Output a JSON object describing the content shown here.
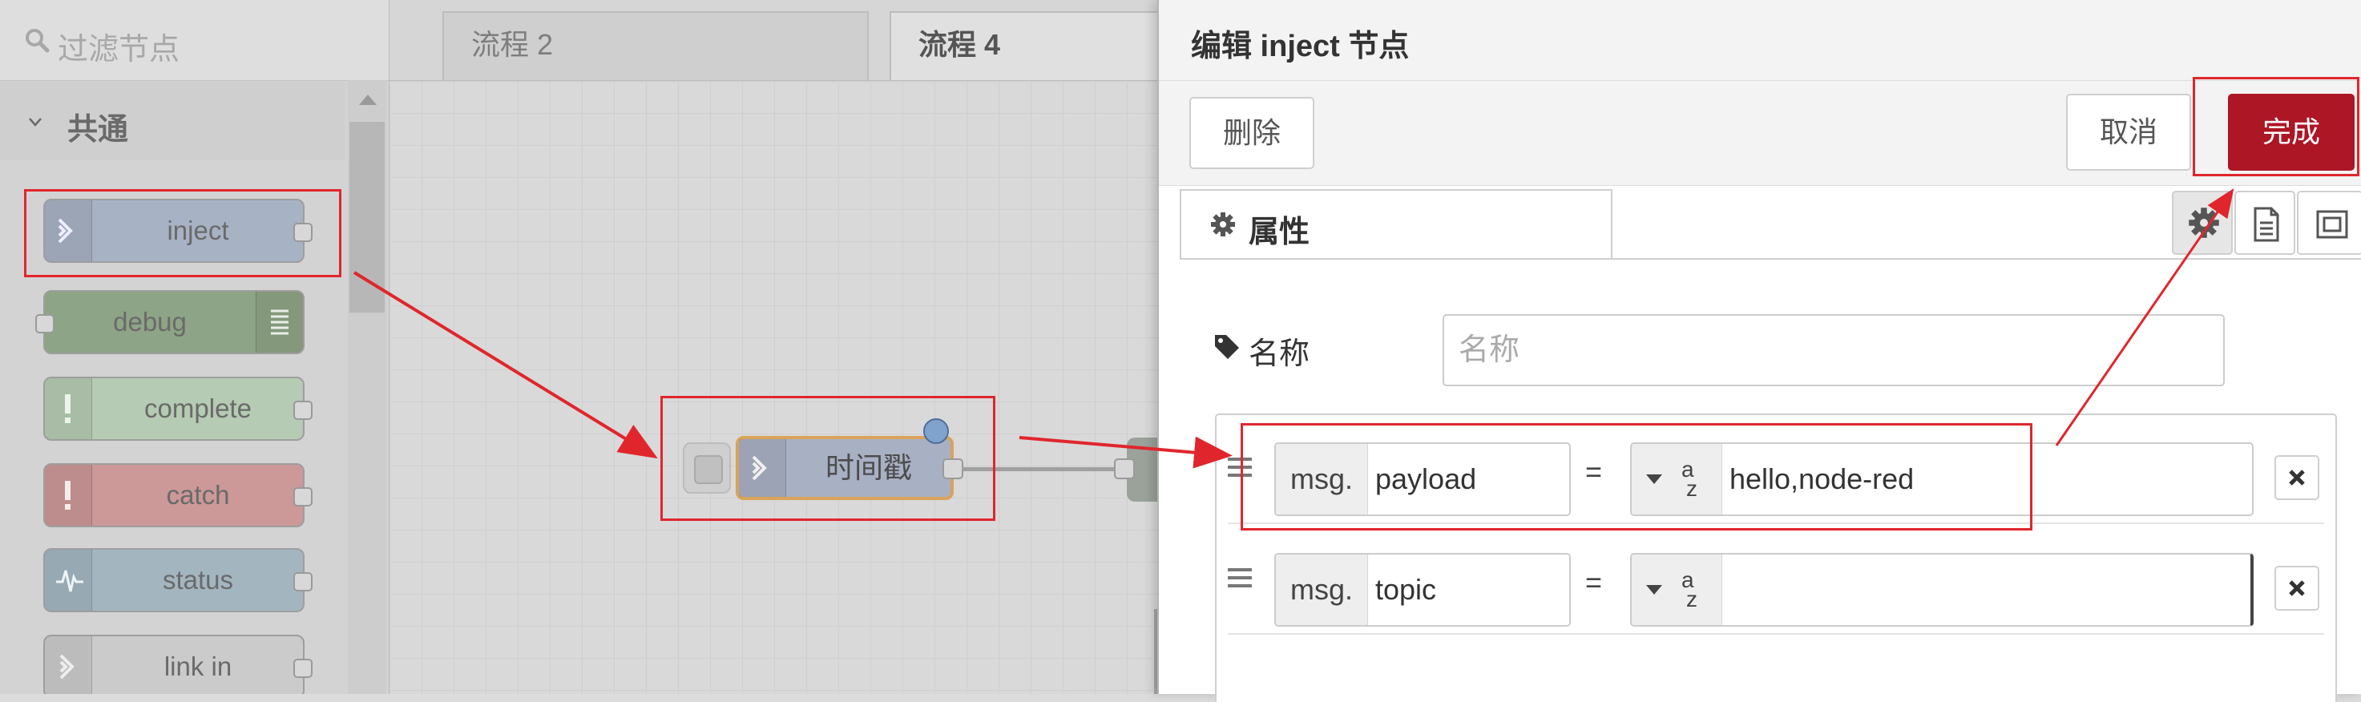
{
  "palette": {
    "filter_placeholder": "过滤节点",
    "category": "共通",
    "nodes": [
      {
        "label": "inject",
        "color": "#a6bbcf"
      },
      {
        "label": "debug",
        "color": "#87a980"
      },
      {
        "label": "complete",
        "color": "#c0deed"
      },
      {
        "label": "catch",
        "color": "#e49191"
      },
      {
        "label": "status",
        "color": "#94c1d0"
      },
      {
        "label": "link in",
        "color": "#dddddd"
      }
    ]
  },
  "workspace": {
    "tabs": [
      "流程 2",
      "流程 4"
    ],
    "node_label": "时间戳"
  },
  "tray": {
    "title": "编辑 inject 节点",
    "delete_label": "删除",
    "cancel_label": "取消",
    "done_label": "完成",
    "properties_tab": "属性",
    "name_label": "名称",
    "name_placeholder": "名称",
    "props": [
      {
        "prefix": "msg.",
        "key": "payload",
        "type_symbol": "az",
        "value": "hello,node-red"
      },
      {
        "prefix": "msg.",
        "key": "topic",
        "type_symbol": "az",
        "value": ""
      }
    ]
  },
  "colors": {
    "accent": "#ad1625",
    "annotation": "#e0262c",
    "node_border_selected": "#d9a35a"
  }
}
